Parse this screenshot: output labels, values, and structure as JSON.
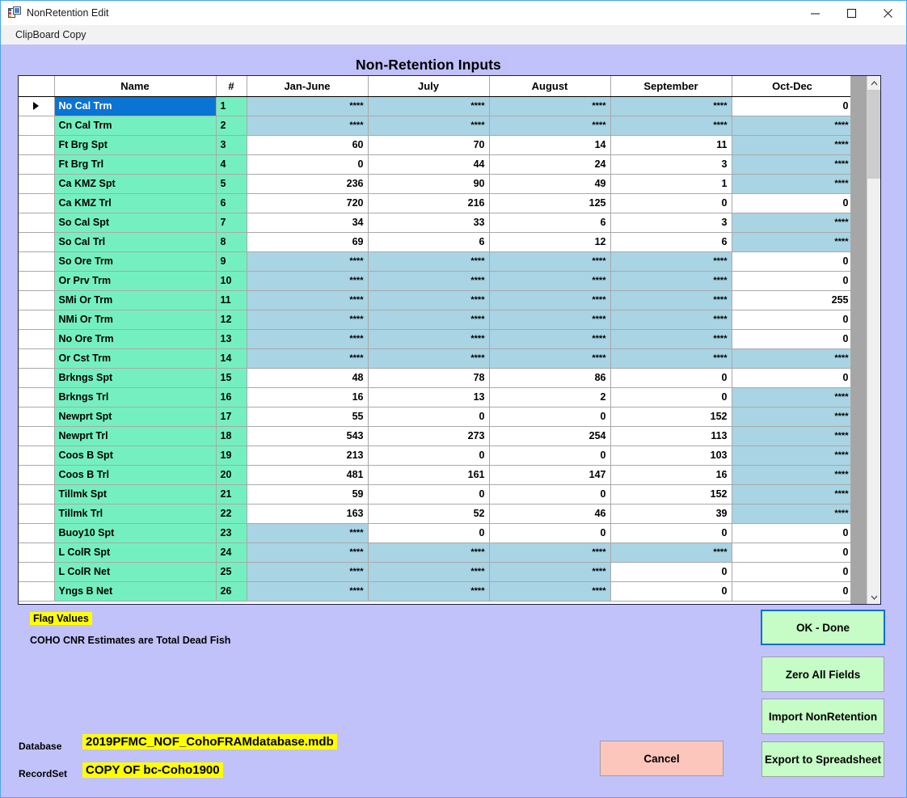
{
  "window": {
    "title": "NonRetention Edit",
    "icon": "application-icon",
    "controls": {
      "minimize": "—",
      "maximize": "□",
      "close": "✕"
    }
  },
  "menubar": {
    "items": [
      {
        "label": "ClipBoard Copy",
        "name": "menu-clipboard-copy"
      }
    ]
  },
  "page": {
    "title": "Non-Retention Inputs"
  },
  "grid": {
    "columns": [
      "",
      "Name",
      "#",
      "Jan-June",
      "July",
      "August",
      "September",
      "Oct-Dec"
    ],
    "selected_row_index": 0,
    "rows": [
      {
        "name": "No Cal Trm",
        "num": "1",
        "values": [
          "****",
          "****",
          "****",
          "****",
          "0"
        ]
      },
      {
        "name": "Cn Cal Trm",
        "num": "2",
        "values": [
          "****",
          "****",
          "****",
          "****",
          "****"
        ]
      },
      {
        "name": "Ft Brg Spt",
        "num": "3",
        "values": [
          "60",
          "70",
          "14",
          "11",
          "****"
        ]
      },
      {
        "name": "Ft Brg Trl",
        "num": "4",
        "values": [
          "0",
          "44",
          "24",
          "3",
          "****"
        ]
      },
      {
        "name": "Ca KMZ Spt",
        "num": "5",
        "values": [
          "236",
          "90",
          "49",
          "1",
          "****"
        ]
      },
      {
        "name": "Ca KMZ Trl",
        "num": "6",
        "values": [
          "720",
          "216",
          "125",
          "0",
          "0"
        ]
      },
      {
        "name": "So Cal Spt",
        "num": "7",
        "values": [
          "34",
          "33",
          "6",
          "3",
          "****"
        ]
      },
      {
        "name": "So Cal Trl",
        "num": "8",
        "values": [
          "69",
          "6",
          "12",
          "6",
          "****"
        ]
      },
      {
        "name": "So Ore Trm",
        "num": "9",
        "values": [
          "****",
          "****",
          "****",
          "****",
          "0"
        ]
      },
      {
        "name": "Or Prv Trm",
        "num": "10",
        "values": [
          "****",
          "****",
          "****",
          "****",
          "0"
        ]
      },
      {
        "name": "SMi Or Trm",
        "num": "11",
        "values": [
          "****",
          "****",
          "****",
          "****",
          "255"
        ]
      },
      {
        "name": "NMi Or Trm",
        "num": "12",
        "values": [
          "****",
          "****",
          "****",
          "****",
          "0"
        ]
      },
      {
        "name": "No Ore Trm",
        "num": "13",
        "values": [
          "****",
          "****",
          "****",
          "****",
          "0"
        ]
      },
      {
        "name": "Or Cst Trm",
        "num": "14",
        "values": [
          "****",
          "****",
          "****",
          "****",
          "****"
        ]
      },
      {
        "name": "Brkngs Spt",
        "num": "15",
        "values": [
          "48",
          "78",
          "86",
          "0",
          "0"
        ]
      },
      {
        "name": "Brkngs Trl",
        "num": "16",
        "values": [
          "16",
          "13",
          "2",
          "0",
          "****"
        ]
      },
      {
        "name": "Newprt Spt",
        "num": "17",
        "values": [
          "55",
          "0",
          "0",
          "152",
          "****"
        ]
      },
      {
        "name": "Newprt Trl",
        "num": "18",
        "values": [
          "543",
          "273",
          "254",
          "113",
          "****"
        ]
      },
      {
        "name": "Coos B Spt",
        "num": "19",
        "values": [
          "213",
          "0",
          "0",
          "103",
          "****"
        ]
      },
      {
        "name": "Coos B Trl",
        "num": "20",
        "values": [
          "481",
          "161",
          "147",
          "16",
          "****"
        ]
      },
      {
        "name": "Tillmk Spt",
        "num": "21",
        "values": [
          "59",
          "0",
          "0",
          "152",
          "****"
        ]
      },
      {
        "name": "Tillmk Trl",
        "num": "22",
        "values": [
          "163",
          "52",
          "46",
          "39",
          "****"
        ]
      },
      {
        "name": "Buoy10 Spt",
        "num": "23",
        "values": [
          "****",
          "0",
          "0",
          "0",
          "0"
        ]
      },
      {
        "name": "L ColR Spt",
        "num": "24",
        "values": [
          "****",
          "****",
          "****",
          "****",
          "0"
        ]
      },
      {
        "name": "L ColR Net",
        "num": "25",
        "values": [
          "****",
          "****",
          "****",
          "0",
          "0"
        ]
      },
      {
        "name": "Yngs B Net",
        "num": "26",
        "values": [
          "****",
          "****",
          "****",
          "0",
          "0"
        ]
      }
    ],
    "flag_token": "****"
  },
  "legend": {
    "flag_values": "Flag Values",
    "note": "COHO CNR Estimates are Total Dead Fish"
  },
  "footer": {
    "database_label": "Database",
    "database_value": "2019PFMC_NOF_CohoFRAMdatabase.mdb",
    "recordset_label": "RecordSet",
    "recordset_value": "COPY OF bc-Coho1900"
  },
  "buttons": {
    "ok": "OK - Done",
    "zero": "Zero All Fields",
    "import": "Import NonRetention",
    "export": "Export to Spreadsheet",
    "cancel": "Cancel"
  },
  "colors": {
    "form_background": "#c2c2fb",
    "name_cell": "#74f0c0",
    "selected_row": "#0a74d4",
    "flag_cell": "#a9d4e4",
    "button_green": "#c6fcc6",
    "button_pink": "#fcc6bd",
    "highlight_yellow": "#ffff00",
    "primary_border": "#0a6fd0"
  },
  "scrollbar": {
    "up_arrow": "▲",
    "down_arrow": "▼"
  }
}
